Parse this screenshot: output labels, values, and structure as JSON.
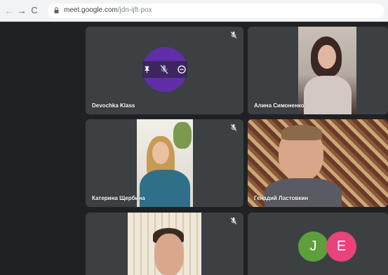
{
  "browser": {
    "url_host": "meet.google.com",
    "url_path": "/jdn-ijft-pox"
  },
  "participants": [
    {
      "name": "Devochka Klass",
      "muted": true,
      "video": false
    },
    {
      "name": "Алина Симоненко",
      "muted": false,
      "video": true
    },
    {
      "name": "Катерина Щербина",
      "muted": true,
      "video": true
    },
    {
      "name": "Генадий Ластовкин",
      "muted": false,
      "video": true
    },
    {
      "name": "",
      "muted": true,
      "video": true
    },
    {
      "name": "",
      "muted": false,
      "video": false
    }
  ],
  "avatars": [
    {
      "initial": "J",
      "color": "#5f9f3b"
    },
    {
      "initial": "E",
      "color": "#e8437a"
    }
  ],
  "colors": {
    "accent_purple": "#5f2ea8",
    "tile_bg": "#3c4043"
  }
}
